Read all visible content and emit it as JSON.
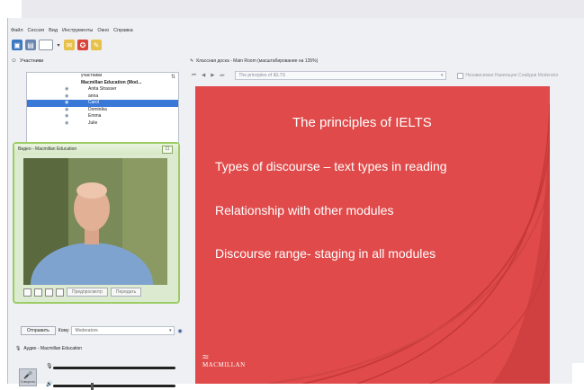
{
  "menu": [
    "Файл",
    "Сессия",
    "Вид",
    "Инструменты",
    "Окно",
    "Справка"
  ],
  "participants_panel": {
    "title": "Участники",
    "header_label": "участники",
    "group_label": "Macmillan Education (Mod...",
    "participants": [
      "Anita Strasser",
      "anna",
      "Carol",
      "Dominika",
      "Emma",
      "Julie"
    ],
    "selected": "Carol"
  },
  "video_window": {
    "title": "Видео - Macmillan Education",
    "preview_label": "Предпросмотр",
    "transmit_label": "Передать"
  },
  "chat": {
    "send_label": "Отправить",
    "to_label": "Кому",
    "to_value": "Moderators"
  },
  "audio": {
    "title": "Аудио - Macmillan Education",
    "talk_label": "Говорить"
  },
  "whiteboard": {
    "title": "Классная доска - Main Room (масштабирование на 135%)",
    "slide_select": "The principles of IELTS",
    "nav_option": "Независимая Навигация Слайдов Moderator"
  },
  "slide": {
    "title": "The principles of IELTS",
    "bullets": [
      "Types of discourse – text types in reading",
      "Relationship with other modules",
      "Discourse range- staging in all modules"
    ],
    "logo_text": "MACMILLAN",
    "background_color": "#e04a4a"
  }
}
